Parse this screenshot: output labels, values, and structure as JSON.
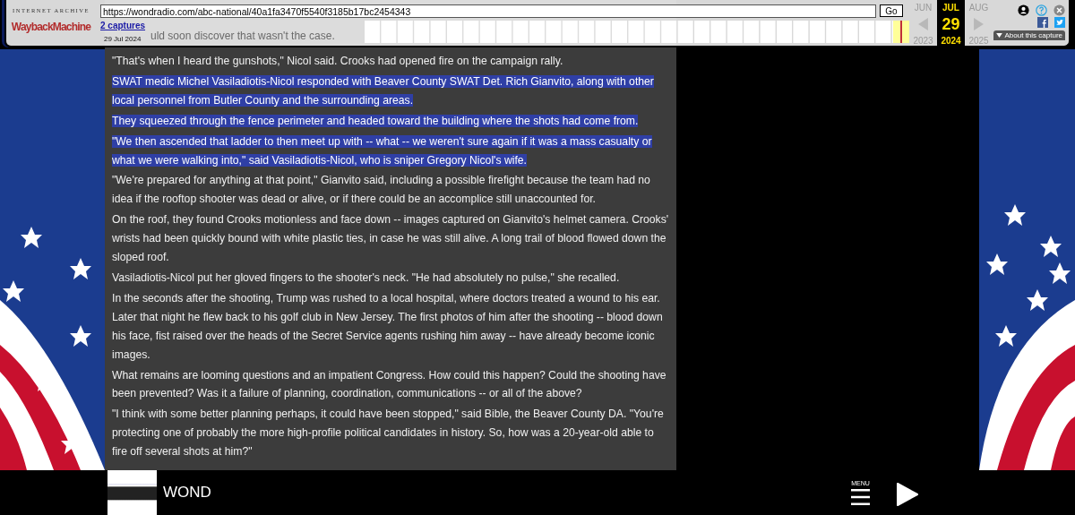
{
  "toolbar": {
    "logo_top": "INTERNET ARCHIVE",
    "logo_main": "WaybackMachine",
    "url": "https://wondradio.com/abc-national/40a1fa3470f5540f3185b17bc2454343",
    "go_button": "Go",
    "captures_link": "2 captures",
    "capture_date": "29 Jul 2024",
    "behind_text": "uld soon discover that wasn't the case.",
    "months": [
      {
        "month": "JUN",
        "year": "2023",
        "selected": false
      },
      {
        "month": "JUL",
        "day": "29",
        "year": "2024",
        "selected": true
      },
      {
        "month": "AUG",
        "year": "2025",
        "selected": false
      }
    ],
    "about_button": "About this capture"
  },
  "article": {
    "paragraphs": [
      {
        "text": "\"That's when I heard the gunshots,\" Nicol said. Crooks had opened fire on the campaign rally.",
        "selected": false
      },
      {
        "text": "SWAT medic Michel Vasiladiotis-Nicol responded with Beaver County SWAT Det. Rich Gianvito, along with other local personnel from Butler County and the surrounding areas.",
        "selected": true
      },
      {
        "text": "They squeezed through the fence perimeter and headed toward the building where the shots had come from.",
        "selected": true
      },
      {
        "text": "\"We then ascended that ladder to then meet up with -- what -- we weren't sure again if it was a mass casualty or what we were walking into,\" said Vasiladiotis-Nicol, who is sniper Gregory Nicol's wife.",
        "selected": true
      },
      {
        "text": "\"We're prepared for anything at that point,\" Gianvito said, including a possible firefight because the team had no idea if the rooftop shooter was dead or alive, or if there could be an accomplice still unaccounted for.",
        "selected": false
      },
      {
        "text": "On the roof, they found Crooks motionless and face down -- images captured on Gianvito's helmet camera. Crooks' wrists had been quickly bound with white plastic ties, in case he was still alive. A long trail of blood flowed down the sloped roof.",
        "selected": false
      },
      {
        "text": "Vasiladiotis-Nicol put her gloved fingers to the shooter's neck. \"He had absolutely no pulse,\" she recalled.",
        "selected": false
      },
      {
        "text": "In the seconds after the shooting, Trump was rushed to a local hospital, where doctors treated a wound to his ear. Later that night he flew back to his golf club in New Jersey. The first photos of him after the shooting -- blood down his face, fist raised over the heads of the Secret Service agents rushing him away -- have already become iconic images.",
        "selected": false
      },
      {
        "text": "What remains are looming questions and an impatient Congress. How could this happen? Could the shooting have been prevented? Was it a failure of planning, coordination, communications -- or all of the above?",
        "selected": false
      },
      {
        "text": "\"I think with some better planning perhaps, it could have been stopped,\" said Bible, the Beaver County DA. \"You're protecting one of probably the more high-profile political candidates in history. So, how was a 20-year-old able to fire off several shots at him?\"",
        "selected": false
      }
    ]
  },
  "player": {
    "station": "WOND",
    "menu_label": "MENU"
  }
}
